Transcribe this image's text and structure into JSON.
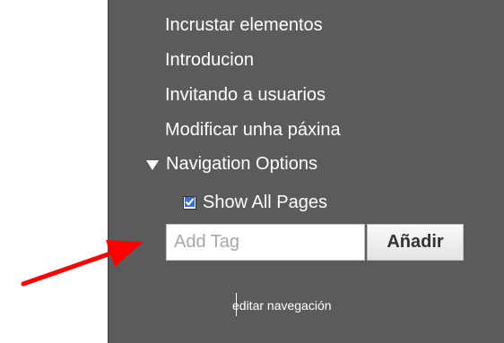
{
  "sidebar": {
    "items": [
      {
        "label": "Incrustar elementos"
      },
      {
        "label": "Introducion"
      },
      {
        "label": "Invitando a usuarios"
      },
      {
        "label": "Modificar unha páxina"
      }
    ],
    "section_label": "Navigation Options",
    "show_all_pages_label": "Show All Pages",
    "show_all_pages_checked": true,
    "tag_input": {
      "placeholder": "Add Tag",
      "value": ""
    },
    "add_button_label": "Añadir",
    "edit_nav_label": "editar navegación"
  },
  "colors": {
    "panel_bg": "#5b5b5b",
    "annotation_arrow": "#ff0000"
  }
}
